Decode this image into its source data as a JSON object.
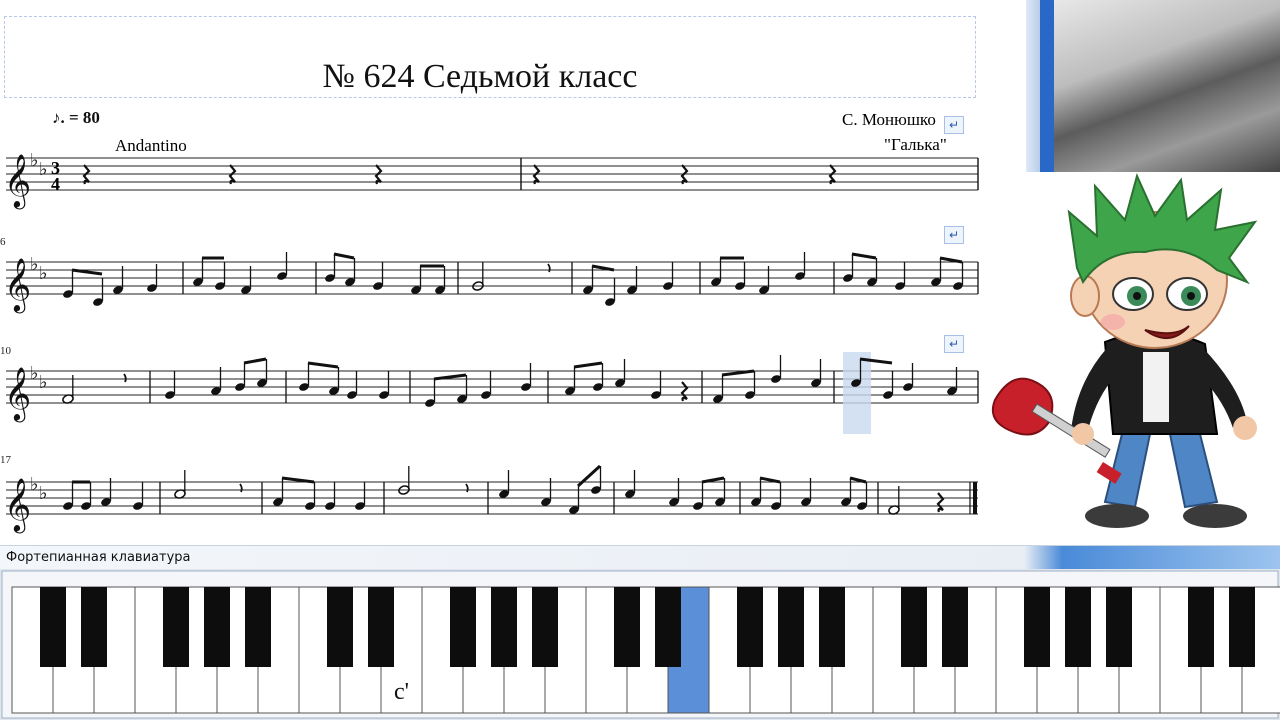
{
  "score": {
    "title": "№ 624 Седьмой класс",
    "tempo_mark": "♪. = 80",
    "tempo_word": "Andantino",
    "composer": "С. Монюшко",
    "subtitle": "\"Галька\"",
    "measure_numbers": [
      "6",
      "10",
      "17"
    ],
    "return_icon": "↵",
    "key_signature": "B-flat major",
    "time_signature": "3/4"
  },
  "side": {
    "photo_icon": "photo-thumbnail",
    "cartoon_icon": "cartoon-boy-with-guitar"
  },
  "keyboard_panel": {
    "title": "Фортепианная клавиатура",
    "note_label": "c'",
    "highlight_color": "#5b8fd8",
    "highlighted_key_index": 16
  }
}
